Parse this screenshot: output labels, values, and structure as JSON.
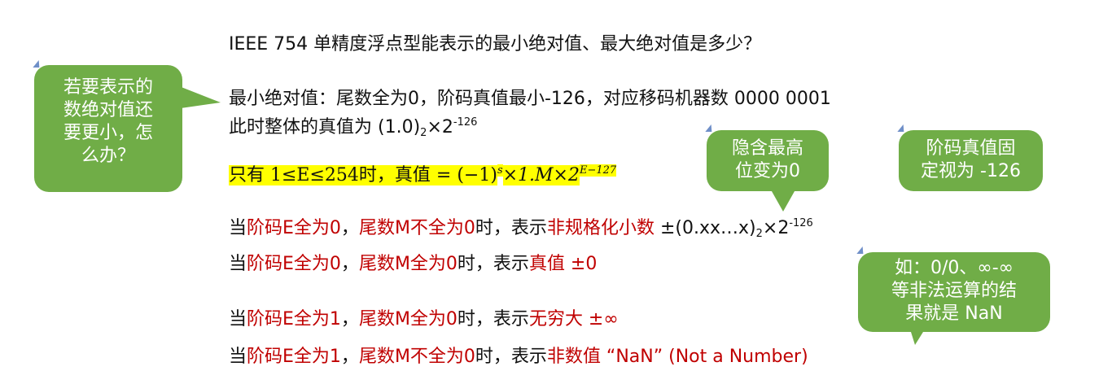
{
  "question": "IEEE 754 单精度浮点型能表示的最小绝对值、最大绝对值是多少？",
  "min_abs": {
    "line1": "最小绝对值：尾数全为0，阶码真值最小-126，对应移码机器数 0000 0001",
    "line2_prefix": "此时整体的真值为 (1.0)",
    "line2_sub": "2",
    "line2_times": "×2",
    "line2_sup": "-126"
  },
  "formula": {
    "prefix": "只有  1≤E≤254时，真值 = (−1)",
    "sup_s": "s",
    "mid": "×1.M×2",
    "sup_e": "E−127"
  },
  "rules": {
    "r1": {
      "p1": "当",
      "p2": "阶码E全为0",
      "p3": "，",
      "p4": "尾数M不全为0",
      "p5": "时，表示",
      "p6": "非规格化小数",
      "p7": "  ±(0.xx…x)",
      "sub": "2",
      "p8": "×2",
      "sup": "-126"
    },
    "r2": {
      "p1": "当",
      "p2": "阶码E全为0",
      "p3": "，",
      "p4": "尾数M全为0",
      "p5": "时，表示",
      "p6": "真值 ±0"
    },
    "r3": {
      "p1": "当",
      "p2": "阶码E全为1",
      "p3": "，",
      "p4": "尾数M全为0",
      "p5": "时，表示",
      "p6": "无穷大 ±∞"
    },
    "r4": {
      "p1": "当",
      "p2": "阶码E全为1",
      "p3": "，",
      "p4": "尾数M不全为0",
      "p5": "时，表示",
      "p6": "非数值 “NaN” (Not a Number)"
    }
  },
  "bubbles": {
    "left": [
      "若要表示的",
      "数绝对值还",
      "要更小，怎",
      "么办？"
    ],
    "hidden_bit": [
      "隐含最高",
      "位变为0"
    ],
    "exponent": [
      "阶码真值固",
      "定视为 -126"
    ],
    "nan": [
      "如：0/0、∞-∞",
      "等非法运算的结",
      "果就是 NaN"
    ]
  },
  "colors": {
    "bubble": "#70ad47",
    "red": "#c00000",
    "highlight": "#ffff00"
  }
}
